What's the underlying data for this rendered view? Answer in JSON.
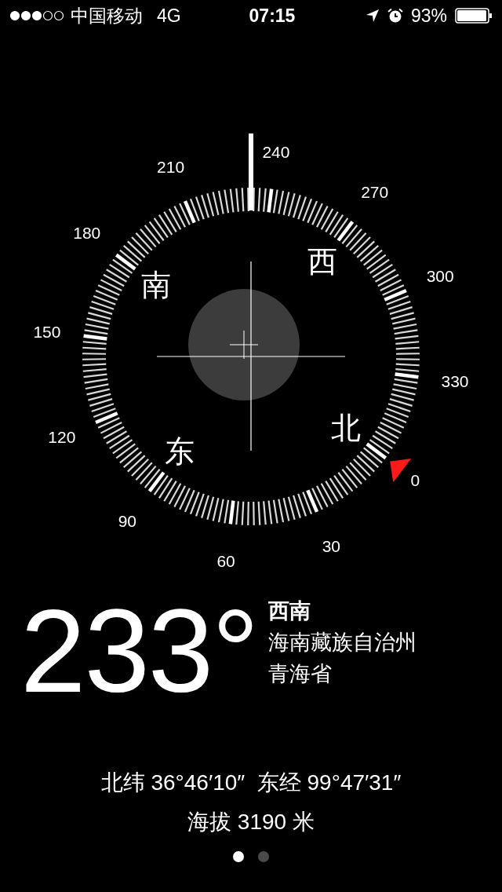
{
  "status_bar": {
    "carrier": "中国移动",
    "network": "4G",
    "time": "07:15",
    "battery": "93%"
  },
  "compass": {
    "dial_labels": [
      "0",
      "30",
      "60",
      "90",
      "120",
      "150",
      "180",
      "210",
      "240",
      "270",
      "300",
      "330"
    ],
    "cardinals": [
      "北",
      "东",
      "南",
      "西"
    ]
  },
  "heading": {
    "degrees": "233°",
    "direction": "西南",
    "region": "海南藏族自治州",
    "province": "青海省"
  },
  "coordinates": "北纬 36°46′10″  东经 99°47′31″",
  "altitude": "海拔 3190 米",
  "pages": [
    {
      "selected": true
    },
    {
      "selected": false
    }
  ]
}
